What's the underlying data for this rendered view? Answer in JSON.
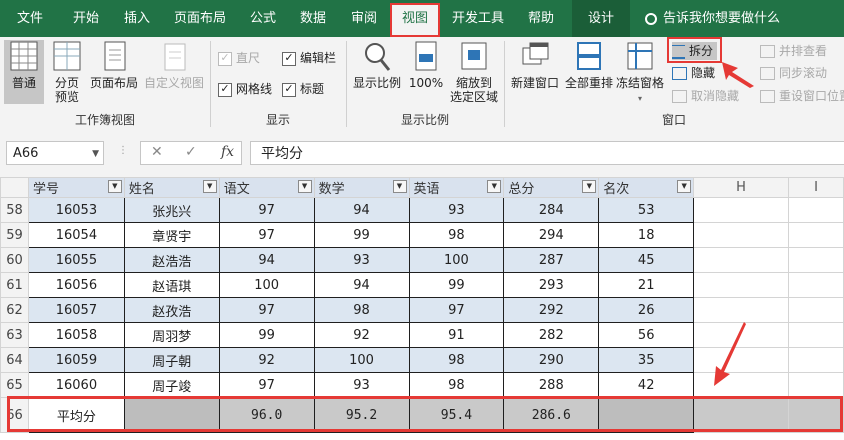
{
  "tabs": [
    "文件",
    "开始",
    "插入",
    "页面布局",
    "公式",
    "数据",
    "审阅",
    "视图",
    "开发工具",
    "帮助",
    "设计"
  ],
  "active_tab": "视图",
  "tell_me": "告诉我你想要做什么",
  "workbook_views": {
    "label": "工作簿视图",
    "buttons": [
      "普通",
      "分页\n预览",
      "页面布局",
      "自定义视图"
    ]
  },
  "show": {
    "label": "显示",
    "checks": [
      {
        "label": "直尺",
        "checked": true,
        "disabled": true
      },
      {
        "label": "编辑栏",
        "checked": true,
        "disabled": false
      },
      {
        "label": "网格线",
        "checked": true,
        "disabled": false
      },
      {
        "label": "标题",
        "checked": true,
        "disabled": false
      }
    ]
  },
  "zoom": {
    "label": "显示比例",
    "buttons": [
      "显示比例",
      "100%",
      "缩放到\n选定区域"
    ]
  },
  "window": {
    "label": "窗口",
    "buttons": [
      "新建窗口",
      "全部重排",
      "冻结窗格"
    ],
    "small": [
      {
        "label": "拆分",
        "disabled": false
      },
      {
        "label": "隐藏",
        "disabled": false
      },
      {
        "label": "取消隐藏",
        "disabled": true
      }
    ],
    "small2": [
      {
        "label": "并排查看",
        "disabled": true
      },
      {
        "label": "同步滚动",
        "disabled": true
      },
      {
        "label": "重设窗口位置",
        "disabled": true
      }
    ]
  },
  "name_box": "A66",
  "formula": "平均分",
  "headers": [
    "学号",
    "姓名",
    "语文",
    "数学",
    "英语",
    "总分",
    "名次"
  ],
  "extra_cols": [
    "H",
    "I"
  ],
  "rows": [
    {
      "num": "58",
      "cells": [
        "16053",
        "张兆兴",
        "97",
        "94",
        "93",
        "284",
        "53"
      ]
    },
    {
      "num": "59",
      "cells": [
        "16054",
        "章贤宇",
        "97",
        "99",
        "98",
        "294",
        "18"
      ]
    },
    {
      "num": "60",
      "cells": [
        "16055",
        "赵浩浩",
        "94",
        "93",
        "100",
        "287",
        "45"
      ]
    },
    {
      "num": "61",
      "cells": [
        "16056",
        "赵语琪",
        "100",
        "94",
        "99",
        "293",
        "21"
      ]
    },
    {
      "num": "62",
      "cells": [
        "16057",
        "赵孜浩",
        "97",
        "98",
        "97",
        "292",
        "26"
      ]
    },
    {
      "num": "63",
      "cells": [
        "16058",
        "周羽梦",
        "99",
        "92",
        "91",
        "282",
        "56"
      ]
    },
    {
      "num": "64",
      "cells": [
        "16059",
        "周子朝",
        "92",
        "100",
        "98",
        "290",
        "35"
      ]
    },
    {
      "num": "65",
      "cells": [
        "16060",
        "周子竣",
        "97",
        "93",
        "98",
        "288",
        "42"
      ]
    }
  ],
  "avg_row": {
    "num": "66",
    "label": "平均分",
    "values": [
      "",
      "96.0",
      "95.2",
      "95.4",
      "286.6",
      ""
    ]
  },
  "colors": {
    "accent": "#217346",
    "highlight": "#e53935",
    "band": "#dce6f1"
  }
}
